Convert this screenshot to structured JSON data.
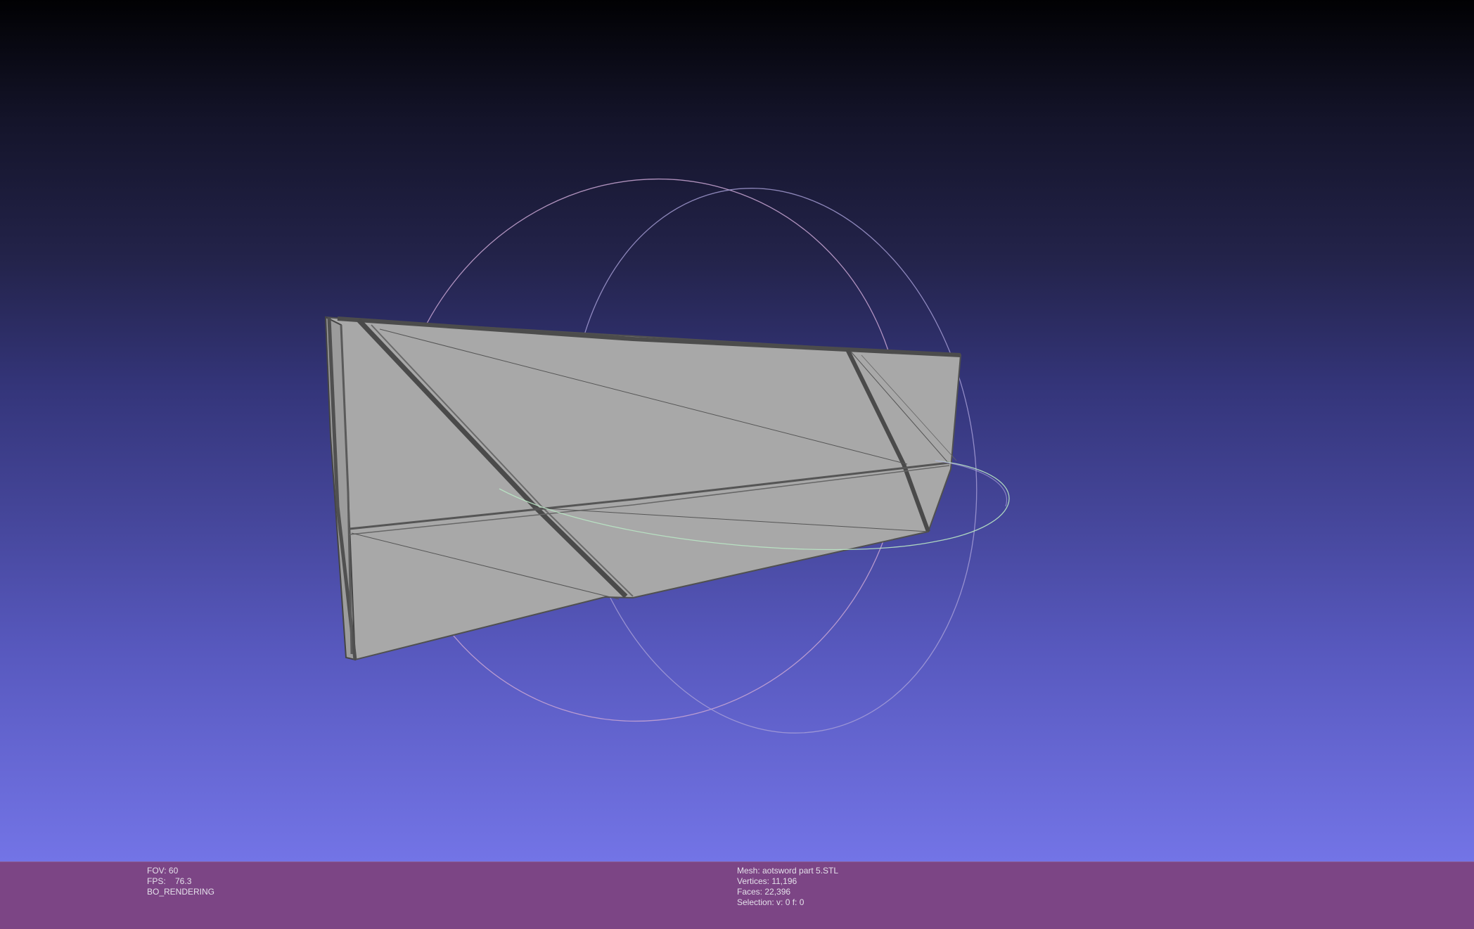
{
  "viewer": {
    "background_top": "#010103",
    "background_bottom": "#7374e6",
    "mesh_color": "#a9a9a9",
    "edge_color": "#4a4a4a",
    "trackball_colors": [
      "#c9a6d4",
      "#a9a0d8",
      "#b9e6c4"
    ]
  },
  "info": {
    "background": "#7c4585",
    "left": {
      "fov": "FOV: 60",
      "fps": "FPS:    76.3",
      "render_mode": "BO_RENDERING"
    },
    "right": {
      "mesh": "Mesh: aotsword part 5.STL",
      "vertices": "Vertices: 11,196",
      "faces": "Faces: 22,396",
      "selection": "Selection: v: 0 f: 0"
    }
  }
}
